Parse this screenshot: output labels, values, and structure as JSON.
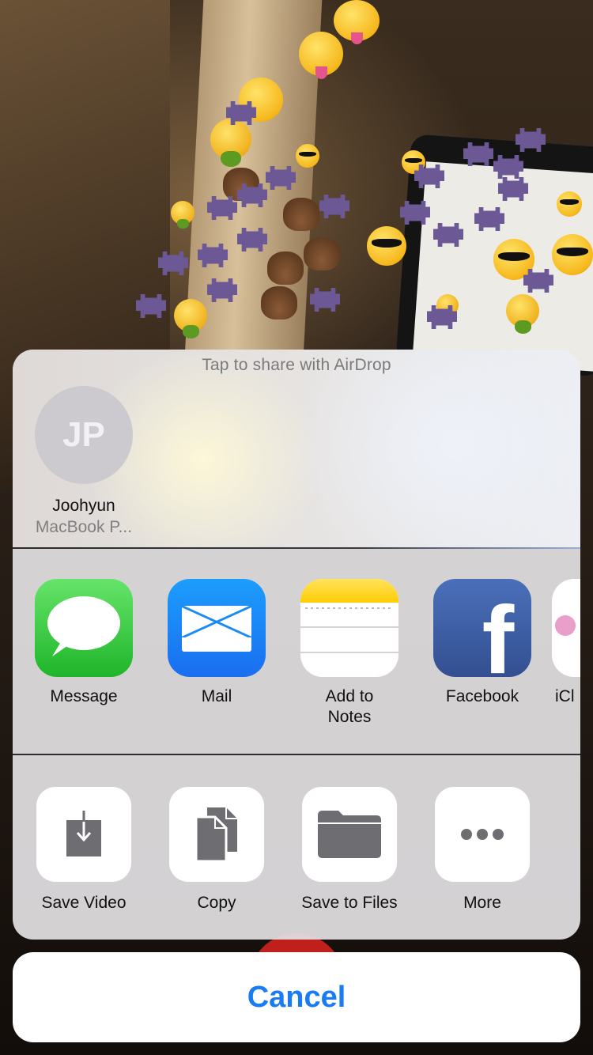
{
  "airdrop": {
    "title": "Tap to share with AirDrop",
    "contacts": [
      {
        "initials": "JP",
        "name": "Joohyun",
        "device": "MacBook P..."
      }
    ]
  },
  "apps": [
    {
      "label": "Message",
      "icon": "messages-icon"
    },
    {
      "label": "Mail",
      "icon": "mail-icon"
    },
    {
      "label": "Add to\nNotes",
      "icon": "notes-icon"
    },
    {
      "label": "Facebook",
      "icon": "facebook-icon"
    },
    {
      "label": "iCl",
      "icon": "icloud-icon"
    }
  ],
  "actions": [
    {
      "label": "Save Video",
      "icon": "save-video-icon"
    },
    {
      "label": "Copy",
      "icon": "copy-icon"
    },
    {
      "label": "Save to Files",
      "icon": "folder-icon"
    },
    {
      "label": "More",
      "icon": "more-icon"
    }
  ],
  "cancel_label": "Cancel",
  "colors": {
    "accent": "#1a7cf3",
    "sheet_background": "#e2e0e2",
    "icon_glyph": "#6e6e72",
    "messages_green": "#2cc33a",
    "mail_blue": "#1a8af5",
    "facebook_blue": "#3b5998",
    "notes_yellow": "#ffd52e"
  }
}
